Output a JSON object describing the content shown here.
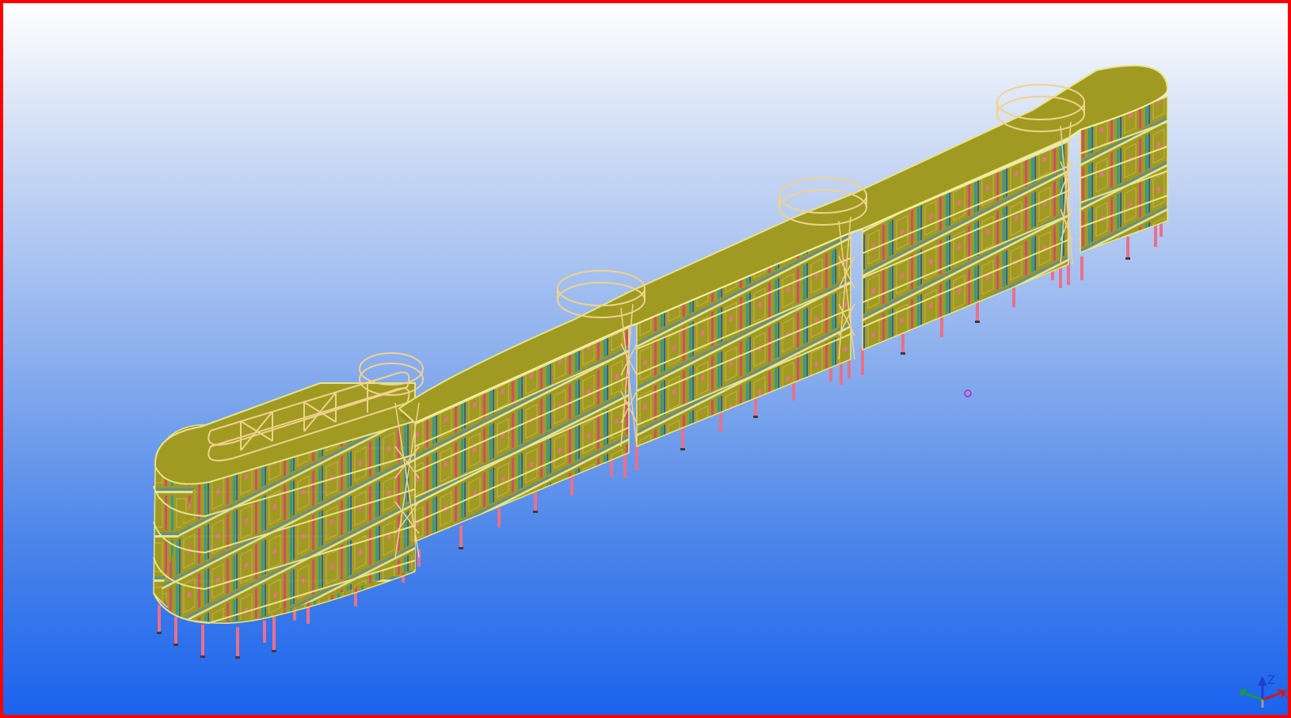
{
  "viewport": {
    "border_color": "#ff0000",
    "background_top": "#ffffff",
    "background_bottom": "#1a63ee"
  },
  "model": {
    "roof_color": "#a09a22",
    "wall_color": "#2e9c8e",
    "column_color": "#e9708a",
    "railing_color": "#f1d28c",
    "edge_color": "#e8e48a",
    "levels": 5
  },
  "axis_triad": {
    "z_label": "Z",
    "x_label": "X",
    "z_color": "#1f3fcf",
    "x_color": "#d01a1a",
    "y_color": "#1a9a3a"
  },
  "cursor_marker": {
    "icon": "circle-marker-icon",
    "color": "#c020c0"
  }
}
